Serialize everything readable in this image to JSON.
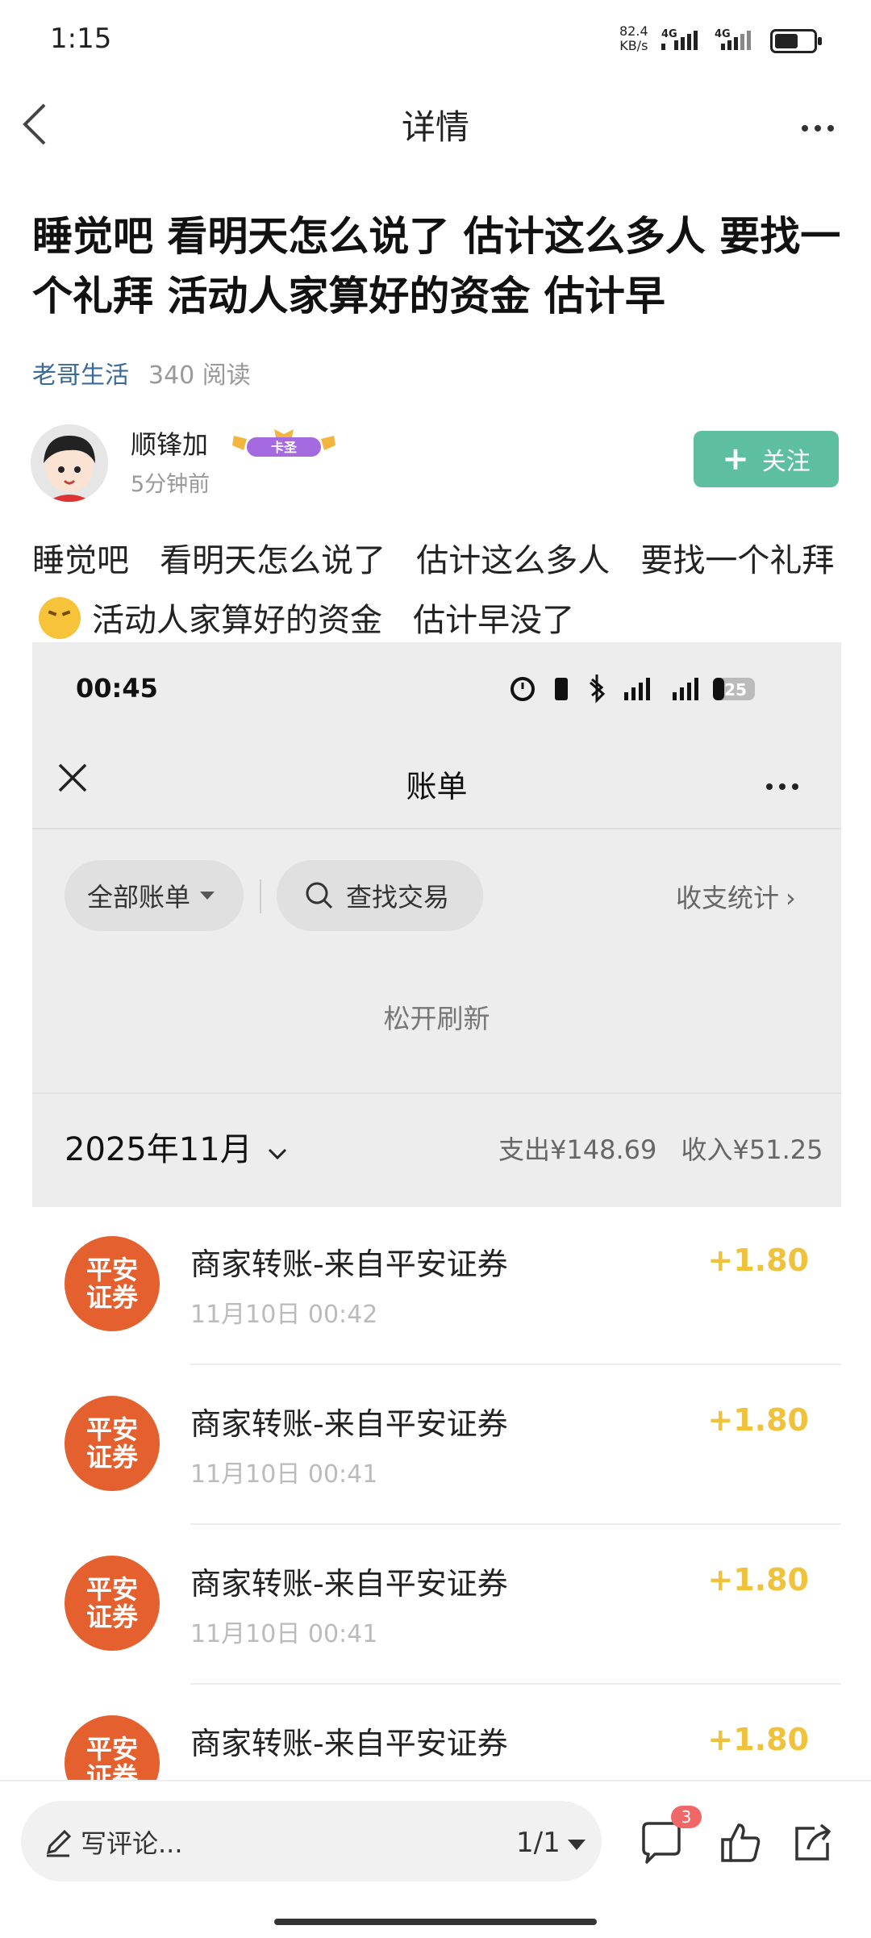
{
  "status_bar": {
    "time": "1:15",
    "net_speed": "82.4",
    "net_unit": "KB/s",
    "net_type_1": "4G",
    "net_type_2": "4G"
  },
  "nav": {
    "title": "详情"
  },
  "article": {
    "title": "睡觉吧 看明天怎么说了 估计这么多人 要找一个礼拜 活动人家算好的资金 估计早",
    "category": "老哥生活",
    "reads": "340 阅读",
    "author": {
      "name": "顺锋加",
      "badge": "卡圣",
      "time_ago": "5分钟前"
    },
    "follow_label": "关注",
    "body_part1": "睡觉吧   看明天怎么说了   估计这么多人   要找一个礼拜",
    "body_part2": "活动人家算好的资金   估计早没了"
  },
  "screenshot": {
    "time": "00:45",
    "battery": "25",
    "title": "账单",
    "filter_all": "全部账单",
    "search_label": "查找交易",
    "stats_label": "收支统计",
    "release_hint": "松开刷新",
    "month": "2025年11月",
    "expense": "支出¥148.69",
    "income": "收入¥51.25",
    "transactions": [
      {
        "logo_line1": "平安",
        "logo_line2": "证券",
        "title": "商家转账-来自平安证券",
        "time": "11月10日 00:42",
        "amount": "+1.80"
      },
      {
        "logo_line1": "平安",
        "logo_line2": "证券",
        "title": "商家转账-来自平安证券",
        "time": "11月10日 00:41",
        "amount": "+1.80"
      },
      {
        "logo_line1": "平安",
        "logo_line2": "证券",
        "title": "商家转账-来自平安证券",
        "time": "11月10日 00:41",
        "amount": "+1.80"
      },
      {
        "logo_line1": "平安",
        "logo_line2": "证券",
        "title": "商家转账-来自平安证券",
        "time": "",
        "amount": "+1.80"
      }
    ]
  },
  "bottom_bar": {
    "comment_placeholder": "写评论...",
    "pager": "1/1",
    "comment_count": "3"
  },
  "colors": {
    "follow_green": "#5dbf9f",
    "amount_yellow": "#f0c23c",
    "logo_orange": "#e4602f",
    "badge_red": "#f06767",
    "category_blue": "#3a6a98"
  }
}
